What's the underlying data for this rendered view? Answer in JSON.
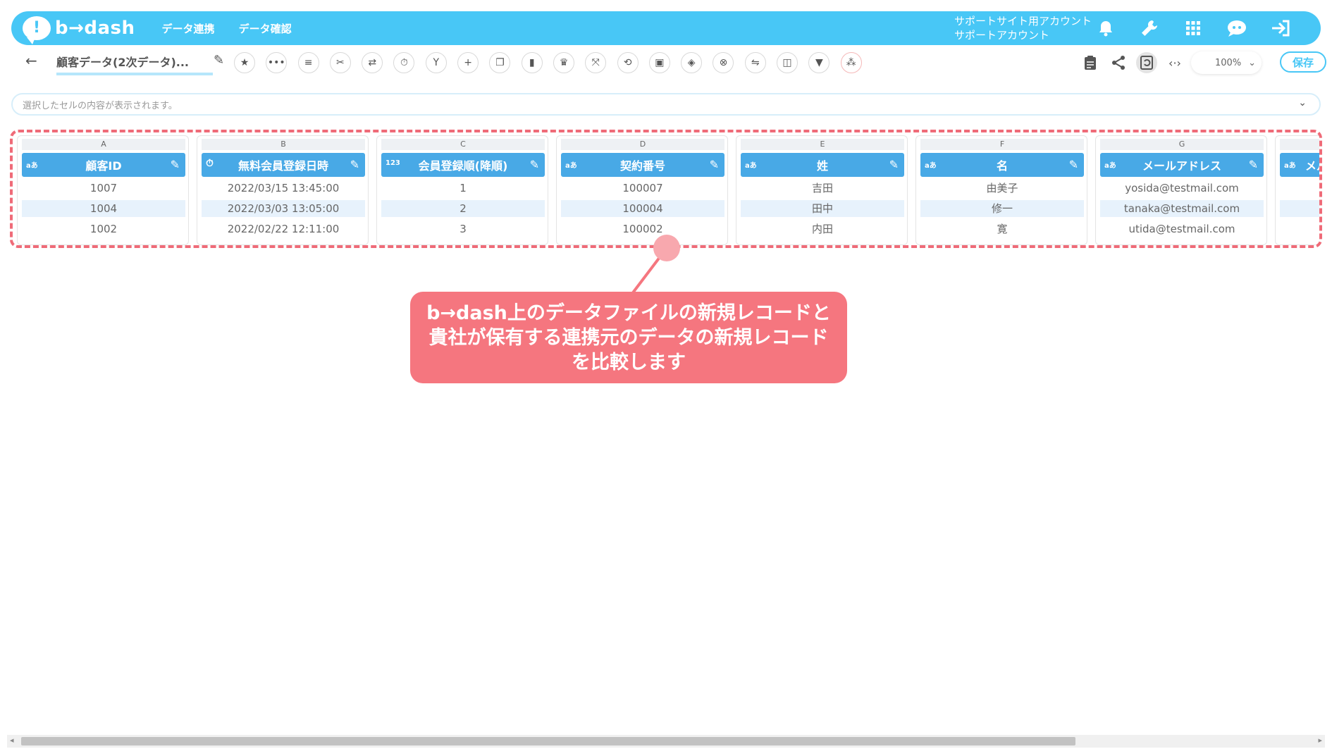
{
  "header": {
    "logo_mark": "!",
    "logo_text": "b→dash",
    "nav": [
      "データ連携",
      "データ確認"
    ],
    "account_line1": "サポートサイト用アカウント",
    "account_line2": "サポートアカウント",
    "icons": [
      "bell-icon",
      "wrench-icon",
      "grid-icon",
      "chat-icon",
      "logout-icon"
    ]
  },
  "toolbar": {
    "back_glyph": "←",
    "file_title": "顧客データ(2次データ)...",
    "save_label": "保存",
    "zoom_value": "100%",
    "tools": [
      "star-icon",
      "more-icon",
      "list-icon",
      "scissors-icon",
      "compress-icon",
      "timer-icon",
      "merge-icon",
      "plus-icon",
      "copy-icon",
      "trash-icon",
      "crown-icon",
      "expand-icon",
      "repeat-icon",
      "lock-icon",
      "cube-icon",
      "cancel-icon",
      "swap-icon",
      "frame-icon",
      "filter-icon",
      "grid-dots-icon"
    ]
  },
  "cellbar": {
    "placeholder": "選択したセルの内容が表示されます。"
  },
  "grid": {
    "columns": [
      {
        "letter": "A",
        "type": "aあ",
        "name": "顧客ID",
        "cells": [
          "1007",
          "1004",
          "1002"
        ]
      },
      {
        "letter": "B",
        "type": "⏱",
        "name": "無料会員登録日時",
        "cells": [
          "2022/03/15 13:45:00",
          "2022/03/03 13:05:00",
          "2022/02/22 12:11:00"
        ]
      },
      {
        "letter": "C",
        "type": "123",
        "name": "会員登録順(降順)",
        "cells": [
          "1",
          "2",
          "3"
        ]
      },
      {
        "letter": "D",
        "type": "aあ",
        "name": "契約番号",
        "cells": [
          "100007",
          "100004",
          "100002"
        ]
      },
      {
        "letter": "E",
        "type": "aあ",
        "name": "姓",
        "cells": [
          "吉田",
          "田中",
          "内田"
        ]
      },
      {
        "letter": "F",
        "type": "aあ",
        "name": "名",
        "cells": [
          "由美子",
          "修一",
          "寛"
        ]
      },
      {
        "letter": "G",
        "type": "aあ",
        "name": "メールアドレス",
        "cells": [
          "yosida@testmail.com",
          "tanaka@testmail.com",
          "utida@testmail.com"
        ]
      },
      {
        "letter": "",
        "type": "aあ",
        "name": "メル",
        "cells": [
          "",
          "",
          ""
        ]
      }
    ]
  },
  "callout": {
    "line1": "b→dash上のデータファイルの新規レコードと",
    "line2": "貴社が保有する連携元のデータの新規レコード",
    "line3": "を比較します"
  }
}
